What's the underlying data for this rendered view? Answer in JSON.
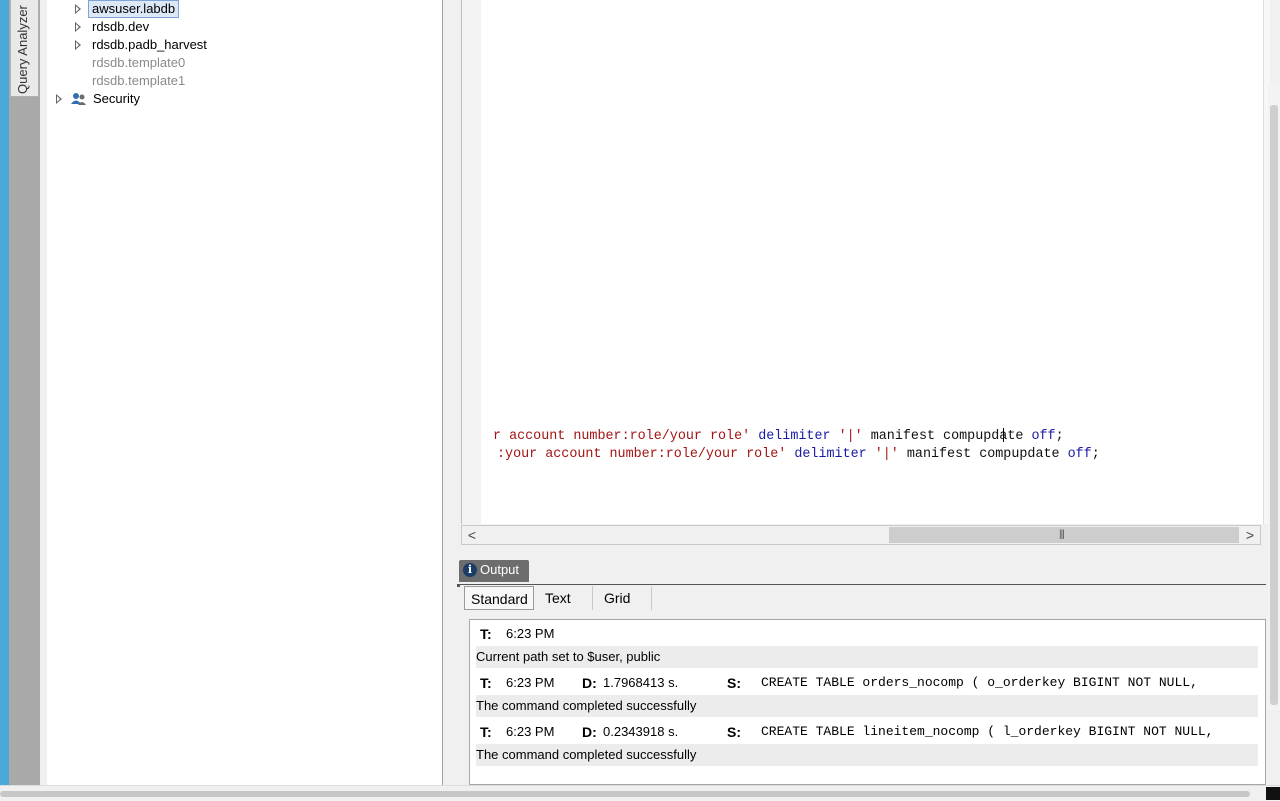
{
  "sidebar": {
    "vertical_tab_label": "Query Analyzer"
  },
  "tree": {
    "items": [
      {
        "label": "awsuser.labdb",
        "selected": true,
        "expandable": true
      },
      {
        "label": "rdsdb.dev",
        "expandable": true
      },
      {
        "label": "rdsdb.padb_harvest",
        "expandable": true
      },
      {
        "label": "rdsdb.template0",
        "disabled": true
      },
      {
        "label": "rdsdb.template1",
        "disabled": true
      },
      {
        "label": "Security",
        "icon": "users-icon",
        "expandable": true
      }
    ]
  },
  "editor": {
    "line1": {
      "s1": "r account number:role/your role'",
      "k1": "delimiter",
      "s2": "'|'",
      "p1": "manifest compupdate",
      "k2": "off",
      "p2": ";"
    },
    "line2": {
      "s1": ":your account number:role/your role'",
      "k1": "delimiter",
      "s2": "'|'",
      "p1": "manifest compupdate",
      "k2": "off",
      "p2": ";"
    }
  },
  "scrollbar": {
    "left_arrow": "<",
    "right_arrow": ">",
    "grip": "|||"
  },
  "output": {
    "tab_label": "Output",
    "tab_icon": "info-icon",
    "subtabs": [
      "Standard",
      "Text",
      "Grid"
    ],
    "active_subtab": "Standard",
    "rows": [
      {
        "t_key": "T:",
        "time": "6:23 PM"
      },
      {
        "message": "Current path set to $user, public"
      },
      {
        "t_key": "T:",
        "time": "6:23 PM",
        "d_key": "D:",
        "duration": "1.7968413 s.",
        "s_key": "S:",
        "sql": "CREATE TABLE orders_nocomp (  o_orderkey BIGINT NOT NULL,"
      },
      {
        "message": "The command completed successfully"
      },
      {
        "t_key": "T:",
        "time": "6:23 PM",
        "d_key": "D:",
        "duration": "0.2343918 s.",
        "s_key": "S:",
        "sql": "CREATE TABLE lineitem_nocomp (  l_orderkey BIGINT NOT NULL,"
      },
      {
        "message": "The command completed successfully"
      }
    ]
  },
  "colors": {
    "accent_strip": "#4aa9d8",
    "keyword": "#1a1aa6",
    "string": "#a31515"
  }
}
